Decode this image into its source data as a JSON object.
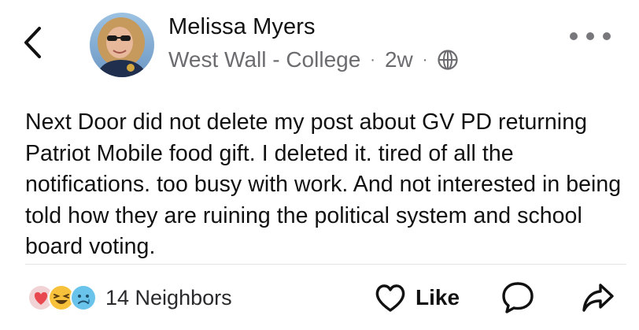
{
  "post": {
    "author": "Melissa Myers",
    "neighborhood": "West Wall - College",
    "separator": "·",
    "age": "2w",
    "visibility_icon": "globe-icon",
    "body": "Next Door did not delete my post about GV PD returning Patriot Mobile food gift. I deleted it. tired of all the notifications. too busy with work. And not interested in being told how they are ruining the political system and school board voting."
  },
  "footer": {
    "reactions": [
      "heart-reaction",
      "laugh-reaction",
      "sad-reaction"
    ],
    "neighbors_count": "14 Neighbors",
    "like_label": "Like"
  },
  "icons": {
    "back": "chevron-left-icon",
    "more": "more-dots-icon",
    "comment": "comment-bubble-icon",
    "share": "share-arrow-icon",
    "like": "heart-outline-icon"
  },
  "colors": {
    "text": "#111111",
    "meta": "#6b6b70",
    "heart": "#e8484f",
    "emoji": "#f7c13c",
    "sad": "#69c3ea"
  }
}
